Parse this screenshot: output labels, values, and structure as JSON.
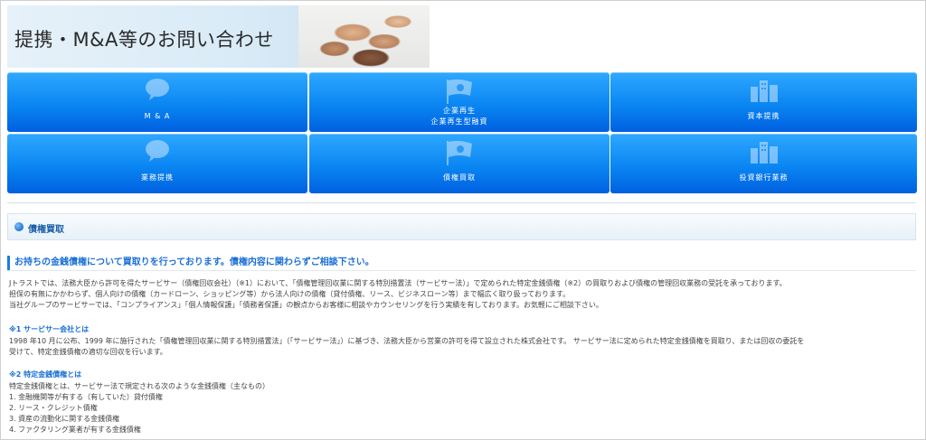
{
  "banner": {
    "title": "提携・M&A等のお問い合わせ"
  },
  "tiles": [
    {
      "label": "M & A",
      "icon": "speech-bubble-icon"
    },
    {
      "label": "企業再生",
      "label2": "企業再生型融資",
      "icon": "flag-icon"
    },
    {
      "label": "資本提携",
      "icon": "buildings-icon"
    },
    {
      "label": "業務提携",
      "icon": "speech-bubble-icon"
    },
    {
      "label": "債権買取",
      "icon": "flag-icon"
    },
    {
      "label": "投資銀行業務",
      "icon": "buildings-icon"
    }
  ],
  "section": {
    "title": "債権買取"
  },
  "lead": "お持ちの金銭債権について買取りを行っております。債権内容に関わらずご相談下さい。",
  "paragraphs": [
    "Jトラストでは、法務大臣から許可を得たサービサー（債権回収会社）（※1）において、「債権管理回収業に関する特別措置法（サービサー法）」で定められた特定金銭債権（※2）の買取りおよび債権の管理回収業務の受託を承っております。",
    "担保の有無にかかわらず、個人向けの債権（カードローン、ショッピング等）から法人向けの債権（貸付債権、リース、ビジネスローン等）まで幅広く取り扱っております。",
    "当社グループのサービサーでは、「コンプライアンス」「個人情報保護」「債務者保護」の観点からお客様に相談やカウンセリングを行う実績を有しております。お気軽にご相談下さい。"
  ],
  "note1": {
    "heading": "※1 サービサー会社とは",
    "lines": [
      "1998 年10 月に公布、1999 年に施行された「債権管理回収業に関する特別措置法」（「サービサー法」）に基づき、法務大臣から営業の許可を得て設立された株式会社です。 サービサー法に定められた特定金銭債権を買取り、または回収の委託を",
      "受けて、特定金銭債権の適切な回収を行います。"
    ]
  },
  "note2": {
    "heading": "※2 特定金銭債権とは",
    "lines": [
      "特定金銭債権とは、サービサー法で規定される次のような金銭債権（主なもの）",
      "1. 金融機関等が有する（有していた）貸付債権",
      "2. リース・クレジット債権",
      "3. 資産の流動化に関する金銭債権",
      "4. ファクタリング業者が有する金銭債権"
    ]
  },
  "colors": {
    "tile": "#0a86f2",
    "accent": "#1a6fd6"
  }
}
